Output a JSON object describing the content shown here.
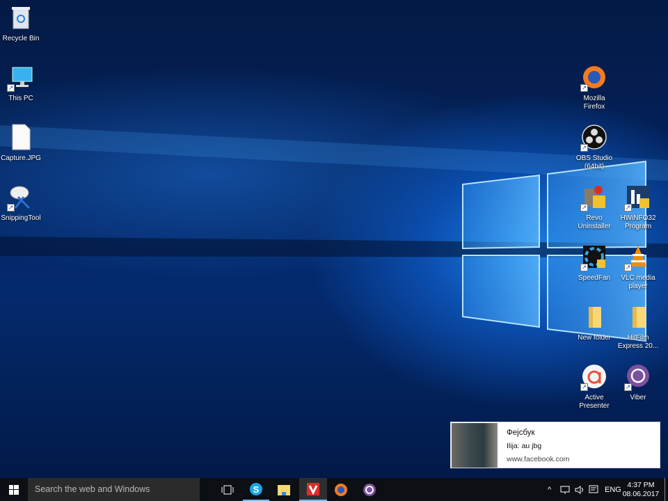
{
  "desktop": {
    "left_icons": [
      {
        "label": "Recycle Bin",
        "icon": "recycle-bin-icon"
      },
      {
        "label": "This PC",
        "icon": "computer-icon"
      },
      {
        "label": "Capture.JPG",
        "icon": "image-file-icon"
      },
      {
        "label": "SnippingTool",
        "icon": "scissors-icon"
      }
    ],
    "right_icons": [
      {
        "label": "Mozilla Firefox",
        "icon": "firefox-icon"
      },
      {
        "label": "OBS Studio (64bit)",
        "icon": "obs-icon"
      },
      {
        "label": "Revo Uninstaller",
        "icon": "revo-icon"
      },
      {
        "label": "HWiNFO32 Program",
        "icon": "hwinfo-icon"
      },
      {
        "label": "SpeedFan",
        "icon": "fan-icon"
      },
      {
        "label": "VLC media player",
        "icon": "vlc-icon"
      },
      {
        "label": "New folder",
        "icon": "folder-icon"
      },
      {
        "label": "HitFilm Express 20...",
        "icon": "folder-icon"
      },
      {
        "label": "Active Presenter",
        "icon": "activepresenter-icon"
      },
      {
        "label": "Viber",
        "icon": "viber-icon"
      }
    ]
  },
  "notification": {
    "title": "Фејсбук",
    "message": "Ilija: au jbg",
    "source": "www.facebook.com"
  },
  "taskbar": {
    "search_placeholder": "Search the web and Windows",
    "apps": [
      "Task View",
      "Skype",
      "File Explorer",
      "Vivaldi",
      "Firefox",
      "Viber"
    ],
    "language": "ENG",
    "time": "4:37 PM",
    "date": "08.06.2017"
  },
  "colors": {
    "accent": "#0a78d7",
    "taskbar": "#0c0f14"
  }
}
